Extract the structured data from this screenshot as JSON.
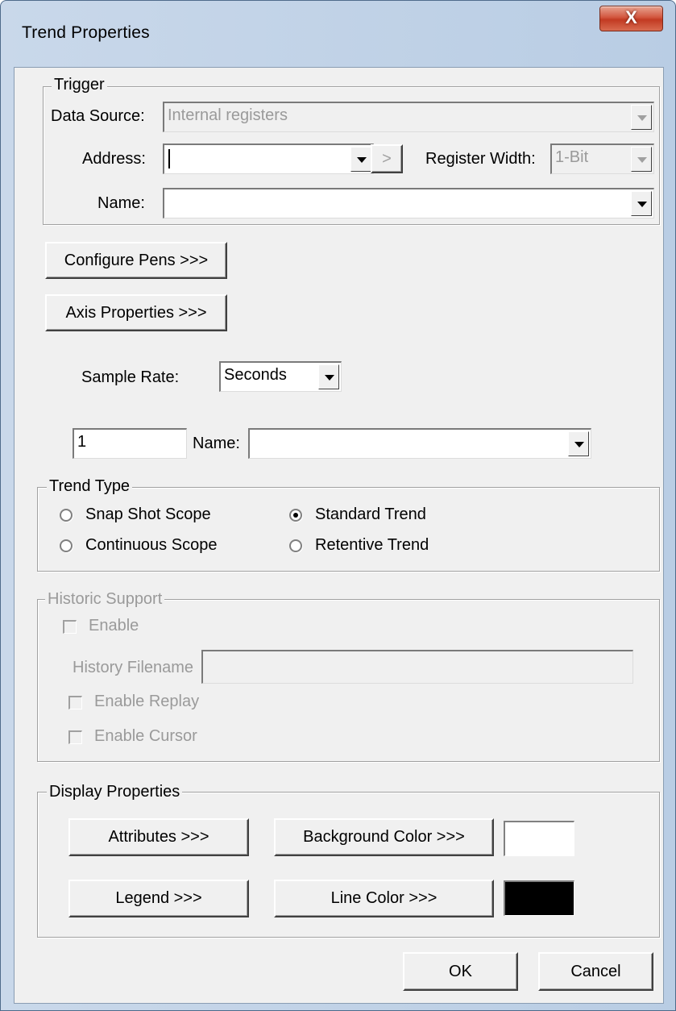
{
  "window": {
    "title": "Trend Properties",
    "close_symbol": "X"
  },
  "trigger": {
    "legend": "Trigger",
    "data_source_label": "Data Source:",
    "data_source_value": "Internal registers",
    "address_label": "Address:",
    "address_value": "",
    "address_go_symbol": ">",
    "register_width_label": "Register Width:",
    "register_width_value": "1-Bit",
    "name_label": "Name:",
    "name_value": ""
  },
  "buttons": {
    "configure_pens": "Configure Pens >>>",
    "axis_properties": "Axis Properties >>>"
  },
  "sample": {
    "rate_label": "Sample Rate:",
    "rate_unit": "Seconds",
    "rate_value": "1",
    "name_label": "Name:",
    "name_value": ""
  },
  "trend_type": {
    "legend": "Trend Type",
    "options": [
      {
        "label": "Snap Shot Scope",
        "selected": false
      },
      {
        "label": "Continuous Scope",
        "selected": false
      },
      {
        "label": "Standard Trend",
        "selected": true
      },
      {
        "label": "Retentive Trend",
        "selected": false
      }
    ]
  },
  "historic": {
    "legend": "Historic Support",
    "enable_label": "Enable",
    "filename_label": "History Filename",
    "filename_value": "",
    "enable_replay_label": "Enable Replay",
    "enable_cursor_label": "Enable Cursor"
  },
  "display": {
    "legend": "Display Properties",
    "attributes": "Attributes >>>",
    "background_color": "Background Color >>>",
    "legend_button": "Legend >>>",
    "line_color": "Line Color >>>",
    "background_swatch": "#ffffff",
    "line_swatch": "#000000"
  },
  "footer": {
    "ok": "OK",
    "cancel": "Cancel"
  }
}
